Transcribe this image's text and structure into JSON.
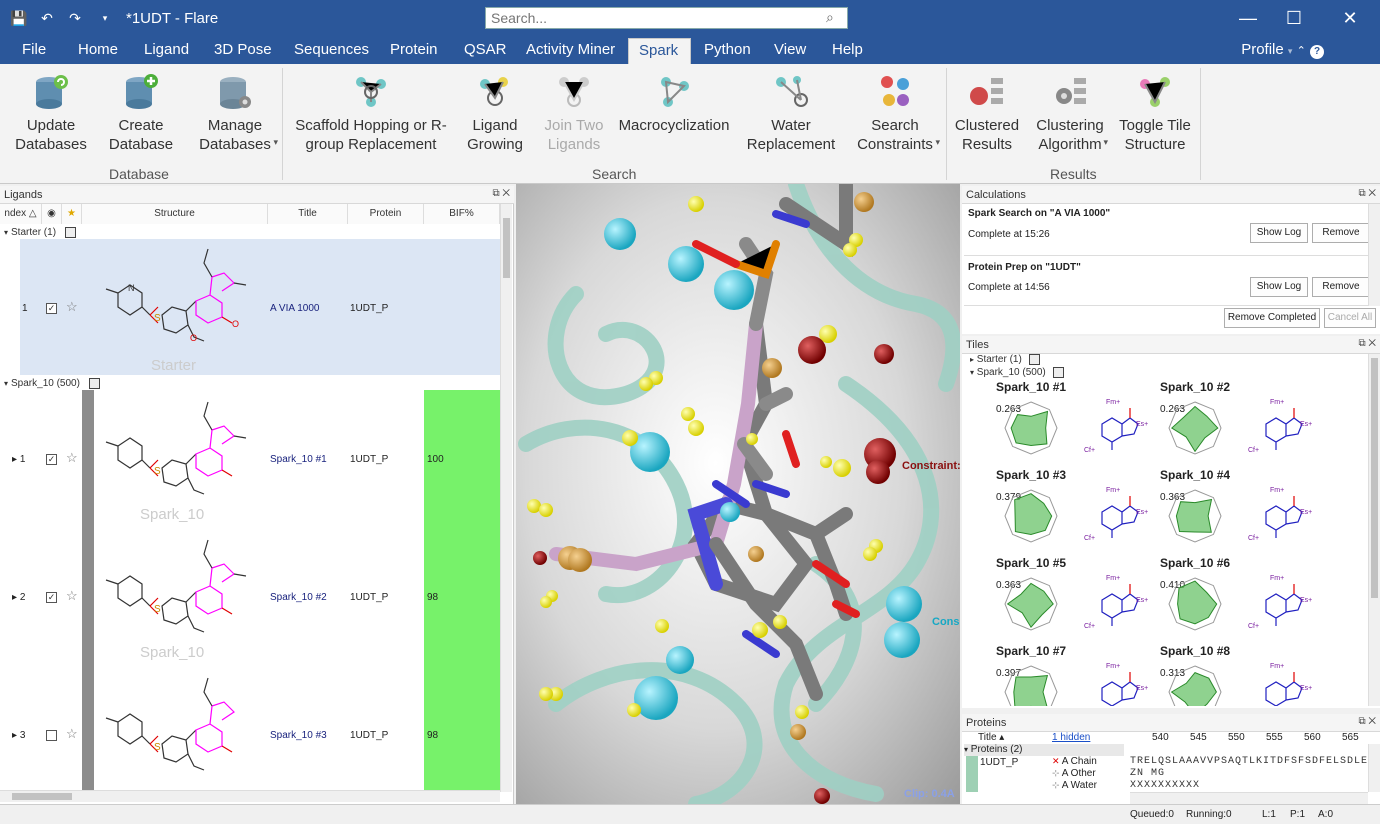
{
  "app": {
    "title": "*1UDT - Flare"
  },
  "search": {
    "placeholder": "Search..."
  },
  "menu": {
    "items": [
      "File",
      "Home",
      "Ligand",
      "3D Pose",
      "Sequences",
      "Protein",
      "QSAR",
      "Activity Miner",
      "Spark",
      "Python",
      "View",
      "Help"
    ],
    "active": "Spark",
    "profile": "Profile"
  },
  "ribbon": {
    "database": {
      "label": "Database",
      "update": "Update Databases",
      "create": "Create Database",
      "manage": "Manage Databases"
    },
    "search": {
      "label": "Search",
      "scaffold": "Scaffold Hopping or R-group Replacement",
      "ligand_growing": "Ligand Growing",
      "join_two": "Join Two Ligands",
      "macrocyclization": "Macrocyclization",
      "water": "Water Replacement",
      "constraints": "Search Constraints"
    },
    "results": {
      "label": "Results",
      "clustered": "Clustered Results",
      "algorithm": "Clustering Algorithm",
      "toggle": "Toggle Tile Structure"
    }
  },
  "ligands_panel": {
    "title": "Ligands",
    "columns": [
      "ndex",
      "Structure",
      "Title",
      "Protein",
      "BIF%"
    ],
    "starter_group": "Starter (1)",
    "spark_group": "Spark_10 (500)",
    "starter": {
      "index": "1",
      "title": "A VIA 1000",
      "protein": "1UDT_P",
      "label": "Starter",
      "checked": true
    },
    "rows": [
      {
        "index": "1",
        "title": "Spark_10 #1",
        "protein": "1UDT_P",
        "bif": "100",
        "label": "Spark_10",
        "checked": true
      },
      {
        "index": "2",
        "title": "Spark_10 #2",
        "protein": "1UDT_P",
        "bif": "98",
        "label": "Spark_10",
        "checked": true
      },
      {
        "index": "3",
        "title": "Spark_10 #3",
        "protein": "1UDT_P",
        "bif": "98",
        "label": "Spark_10",
        "checked": false
      }
    ]
  },
  "viewport": {
    "constraint_label": "Constraint:",
    "constraint_label2": "Cons",
    "clip": "Clip: 0.4A"
  },
  "calculations": {
    "title": "Calculations",
    "jobs": [
      {
        "name": "Spark Search on \"A VIA 1000\"",
        "status": "Complete at 15:26"
      },
      {
        "name": "Protein Prep on \"1UDT\"",
        "status": "Complete at 14:56"
      }
    ],
    "show_log": "Show Log",
    "remove": "Remove",
    "remove_completed": "Remove Completed",
    "cancel_all": "Cancel All"
  },
  "tiles": {
    "title": "Tiles",
    "starter_group": "Starter (1)",
    "spark_group": "Spark_10 (500)",
    "items": [
      {
        "name": "Spark_10 #1",
        "score": "0.263"
      },
      {
        "name": "Spark_10 #2",
        "score": "0.263"
      },
      {
        "name": "Spark_10 #3",
        "score": "0.379"
      },
      {
        "name": "Spark_10 #4",
        "score": "0.363"
      },
      {
        "name": "Spark_10 #5",
        "score": "0.363"
      },
      {
        "name": "Spark_10 #6",
        "score": "0.410"
      },
      {
        "name": "Spark_10 #7",
        "score": "0.397"
      },
      {
        "name": "Spark_10 #8",
        "score": "0.313"
      }
    ],
    "atom_labels": {
      "fm": "Fm+",
      "es": "Es+",
      "cf": "Cf+"
    }
  },
  "proteins": {
    "title": "Proteins",
    "col_title": "Title",
    "hidden": "1 hidden",
    "ticks": [
      "540",
      "545",
      "550",
      "555",
      "560",
      "565"
    ],
    "group": "Proteins (2)",
    "name": "1UDT_P",
    "chains": [
      "A Chain",
      "A Other",
      "A Water"
    ],
    "seq1": "TRELQSLAAAVVPSAQTLKITDFSFSDFELSDLE",
    "seq2": "ZN MG",
    "seq3": "XXXXXXXXXX"
  },
  "status": {
    "queued": "Queued:0",
    "running": "Running:0",
    "l": "L:1",
    "p": "P:1",
    "a": "A:0"
  },
  "colors": {
    "accent": "#2b579a",
    "bif_fill": "#77f26a",
    "ligand_select": "#dce6f4",
    "ribbon_bg": "#f3f3f3"
  }
}
